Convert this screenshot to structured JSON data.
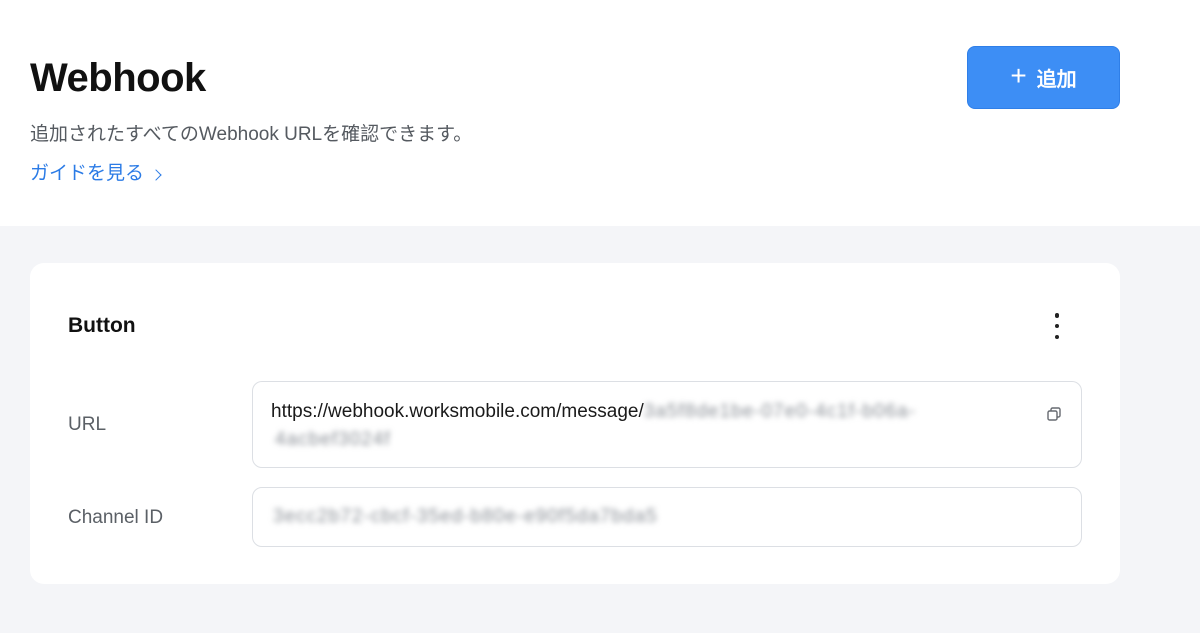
{
  "header": {
    "title": "Webhook",
    "description": "追加されたすべてのWebhook URLを確認できます。",
    "guide_link": "ガイドを見る",
    "add_button": {
      "icon": "plus-icon",
      "label": "追加"
    }
  },
  "colors": {
    "accent": "#3d8ef5",
    "link": "#2b7be6",
    "background": "#f4f5f8"
  },
  "webhook_card": {
    "name": "Button",
    "menu_icon": "kebab-menu-icon",
    "fields": {
      "url": {
        "label": "URL",
        "value_prefix": "https://webhook.worksmobile.com/message/",
        "value_hidden_line1": "3a5f8de1be-07e0-4c1f-b06a-",
        "value_hidden_line2": "4acbef3024f",
        "copy_icon": "copy-icon"
      },
      "channel_id": {
        "label": "Channel ID",
        "value_hidden": "3ecc2b72-cbcf-35ed-b80e-e90f5da7bda5"
      }
    }
  }
}
